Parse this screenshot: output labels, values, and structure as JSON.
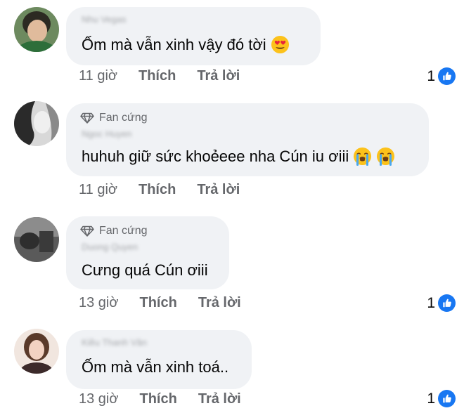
{
  "colors": {
    "bubble_background": "#f0f2f5",
    "secondary_text": "#65676b",
    "primary_text": "#050505",
    "like_blue": "#1877f2"
  },
  "comments": [
    {
      "author": "Nhu Vegas",
      "author_blurred": true,
      "badge": null,
      "text": "Ốm mà vẫn xinh vậy đó tời",
      "emojis": [
        "heart-eyes"
      ],
      "time": "11 giờ",
      "like_label": "Thích",
      "reply_label": "Trả lời",
      "reaction_count": "1",
      "reaction_icon": "like-icon"
    },
    {
      "author": "Ngoc Huyen",
      "author_blurred": true,
      "badge": "Fan cứng",
      "badge_icon": "diamond-icon",
      "text": "huhuh giữ sức khoẻeee nha Cún iu ơiii",
      "emojis": [
        "loudly-crying",
        "loudly-crying"
      ],
      "time": "11 giờ",
      "like_label": "Thích",
      "reply_label": "Trả lời",
      "reaction_count": null
    },
    {
      "author": "Duong Quyen",
      "author_blurred": true,
      "badge": "Fan cứng",
      "badge_icon": "diamond-icon",
      "text": "Cưng quá Cún ơiii",
      "emojis": [],
      "time": "13 giờ",
      "like_label": "Thích",
      "reply_label": "Trả lời",
      "reaction_count": "1",
      "reaction_icon": "like-icon"
    },
    {
      "author": "Kiều Thanh Vân",
      "author_blurred": true,
      "badge": null,
      "text": "Ốm mà vẫn xinh toá..",
      "emojis": [],
      "time": "13 giờ",
      "like_label": "Thích",
      "reply_label": "Trả lời",
      "reaction_count": "1",
      "reaction_icon": "like-icon"
    }
  ]
}
